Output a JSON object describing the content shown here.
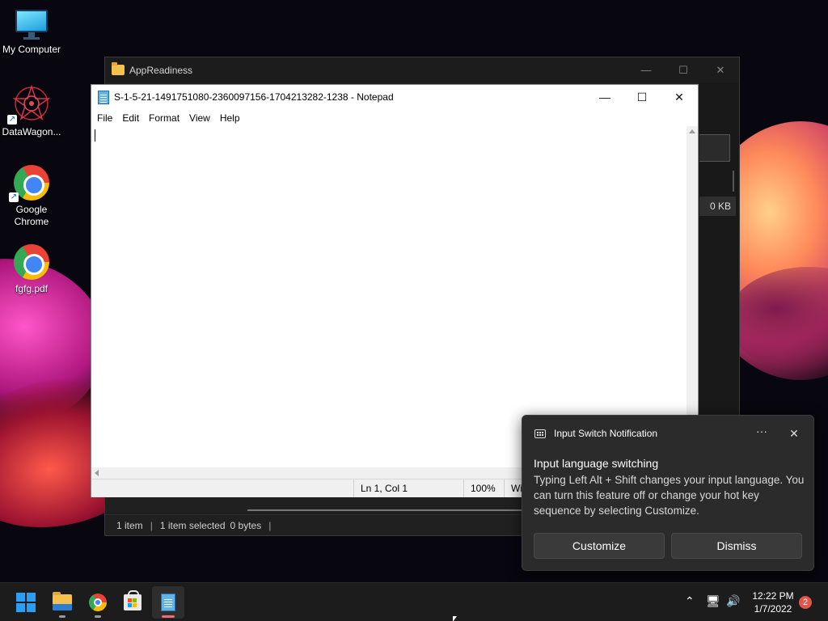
{
  "desktop": {
    "icons": [
      {
        "label": "My Computer",
        "icon": "monitor-icon"
      },
      {
        "label": "DataWagon...",
        "icon": "datawagon-icon"
      },
      {
        "label": "Google Chrome",
        "icon": "chrome-icon"
      },
      {
        "label": "fgfg.pdf",
        "icon": "chrome-icon"
      }
    ]
  },
  "explorer": {
    "title": "AppReadiness",
    "size_cell": "0 KB",
    "status": {
      "count": "1 item",
      "selected": "1 item selected",
      "bytes": "0 bytes"
    }
  },
  "notepad": {
    "title": "S-1-5-21-1491751080-2360097156-1704213282-1238 - Notepad",
    "menu": [
      "File",
      "Edit",
      "Format",
      "View",
      "Help"
    ],
    "content": "",
    "status": {
      "position": "Ln 1, Col 1",
      "zoom": "100%",
      "line_ending": "Wi"
    }
  },
  "notification": {
    "app_name": "Input Switch Notification",
    "title": "Input language switching",
    "body": "Typing Left Alt + Shift changes your input language. You can turn this feature off or change your hot key sequence by selecting Customize.",
    "more_label": "···",
    "buttons": {
      "customize": "Customize",
      "dismiss": "Dismiss"
    }
  },
  "taskbar": {
    "apps": [
      "start-icon",
      "file-explorer-icon",
      "chrome-icon",
      "store-icon",
      "notepad-icon"
    ],
    "clock": {
      "time": "12:22 PM",
      "date": "1/7/2022"
    },
    "notification_count": "2"
  }
}
